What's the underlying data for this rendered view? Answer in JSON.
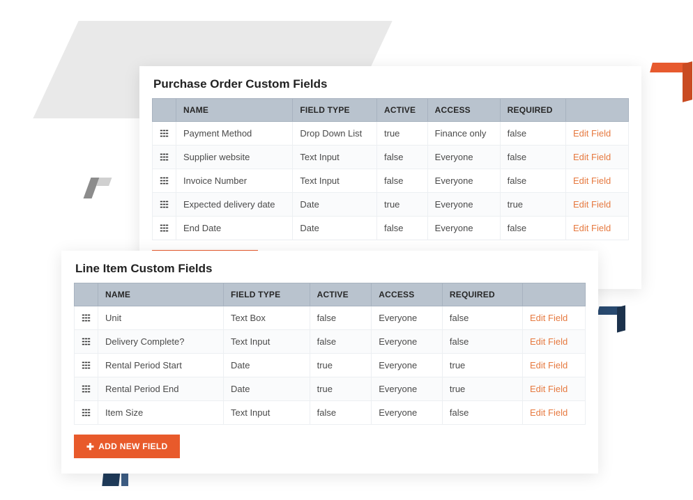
{
  "headers": {
    "name": "NAME",
    "fieldType": "FIELD TYPE",
    "active": "ACTIVE",
    "access": "ACCESS",
    "required": "REQUIRED"
  },
  "editLabel": "Edit Field",
  "addBtn": "ADD NEW FIELD",
  "panels": {
    "po": {
      "title": "Purchase Order Custom Fields",
      "rows": [
        {
          "name": "Payment Method",
          "fieldType": "Drop Down List",
          "active": "true",
          "access": "Finance only",
          "required": "false"
        },
        {
          "name": "Supplier website",
          "fieldType": "Text Input",
          "active": "false",
          "access": "Everyone",
          "required": "false"
        },
        {
          "name": "Invoice Number",
          "fieldType": "Text Input",
          "active": "false",
          "access": "Everyone",
          "required": "false"
        },
        {
          "name": "Expected delivery date",
          "fieldType": "Date",
          "active": "true",
          "access": "Everyone",
          "required": "true"
        },
        {
          "name": "End Date",
          "fieldType": "Date",
          "active": "false",
          "access": "Everyone",
          "required": "false"
        }
      ]
    },
    "li": {
      "title": "Line Item Custom Fields",
      "rows": [
        {
          "name": "Unit",
          "fieldType": "Text Box",
          "active": "false",
          "access": "Everyone",
          "required": "false"
        },
        {
          "name": "Delivery Complete?",
          "fieldType": "Text Input",
          "active": "false",
          "access": "Everyone",
          "required": "false"
        },
        {
          "name": "Rental Period Start",
          "fieldType": "Date",
          "active": "true",
          "access": "Everyone",
          "required": "true"
        },
        {
          "name": "Rental Period End",
          "fieldType": "Date",
          "active": "true",
          "access": "Everyone",
          "required": "true"
        },
        {
          "name": "Item Size",
          "fieldType": "Text Input",
          "active": "false",
          "access": "Everyone",
          "required": "false"
        }
      ]
    }
  }
}
